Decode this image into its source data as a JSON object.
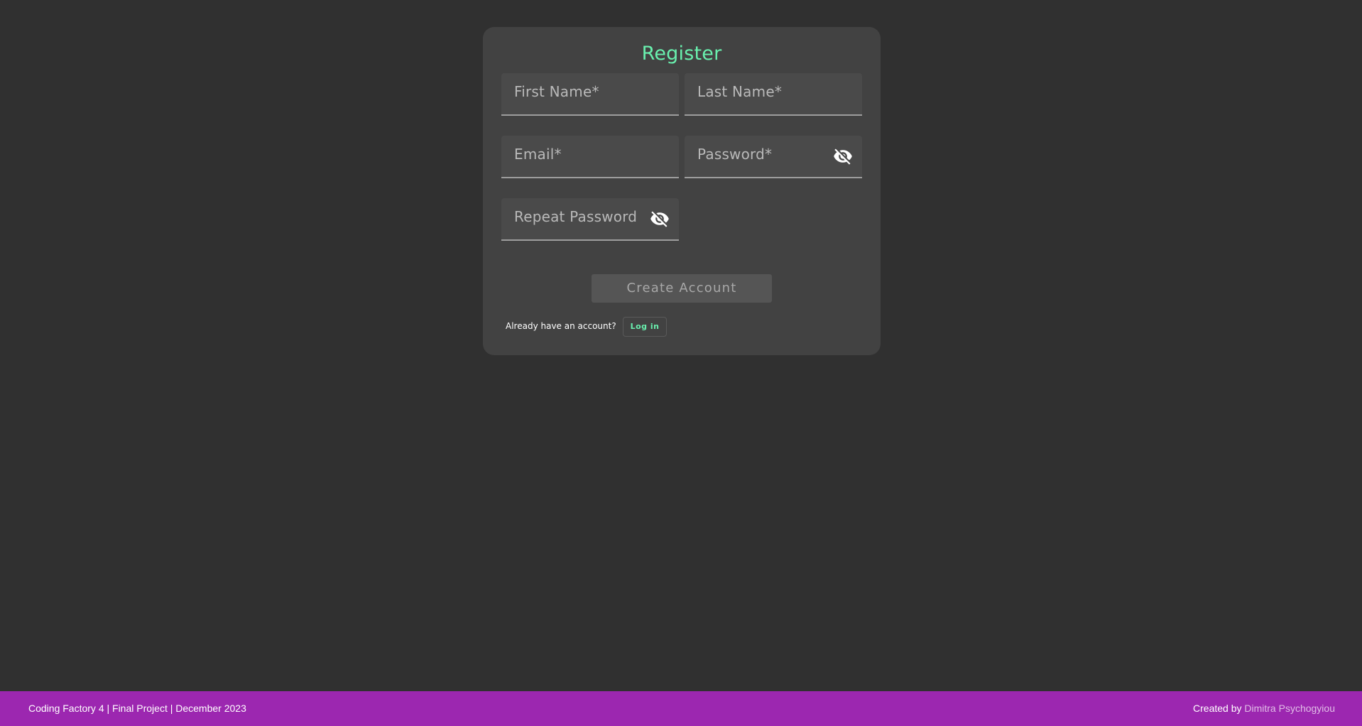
{
  "colors": {
    "background": "#303030",
    "card": "#424242",
    "accent": "#69f0ae",
    "footer": "#9c27b0",
    "link": "#e1bee7"
  },
  "register": {
    "title": "Register",
    "fields": {
      "first_name": {
        "placeholder": "First Name*",
        "value": ""
      },
      "last_name": {
        "placeholder": "Last Name*",
        "value": ""
      },
      "email": {
        "placeholder": "Email*",
        "value": ""
      },
      "password": {
        "placeholder": "Password*",
        "value": "",
        "toggle_icon": "eye-off-icon"
      },
      "repeat_password": {
        "placeholder": "Repeat Password",
        "value": "",
        "toggle_icon": "eye-off-icon"
      }
    },
    "submit_label": "Create Account",
    "login_prompt": "Already have an account?",
    "login_label": "Log in"
  },
  "footer": {
    "left_text": "Coding Factory 4 | Final Project | December 2023",
    "created_by": "Created by",
    "author": "Dimitra Psychogyiou"
  }
}
